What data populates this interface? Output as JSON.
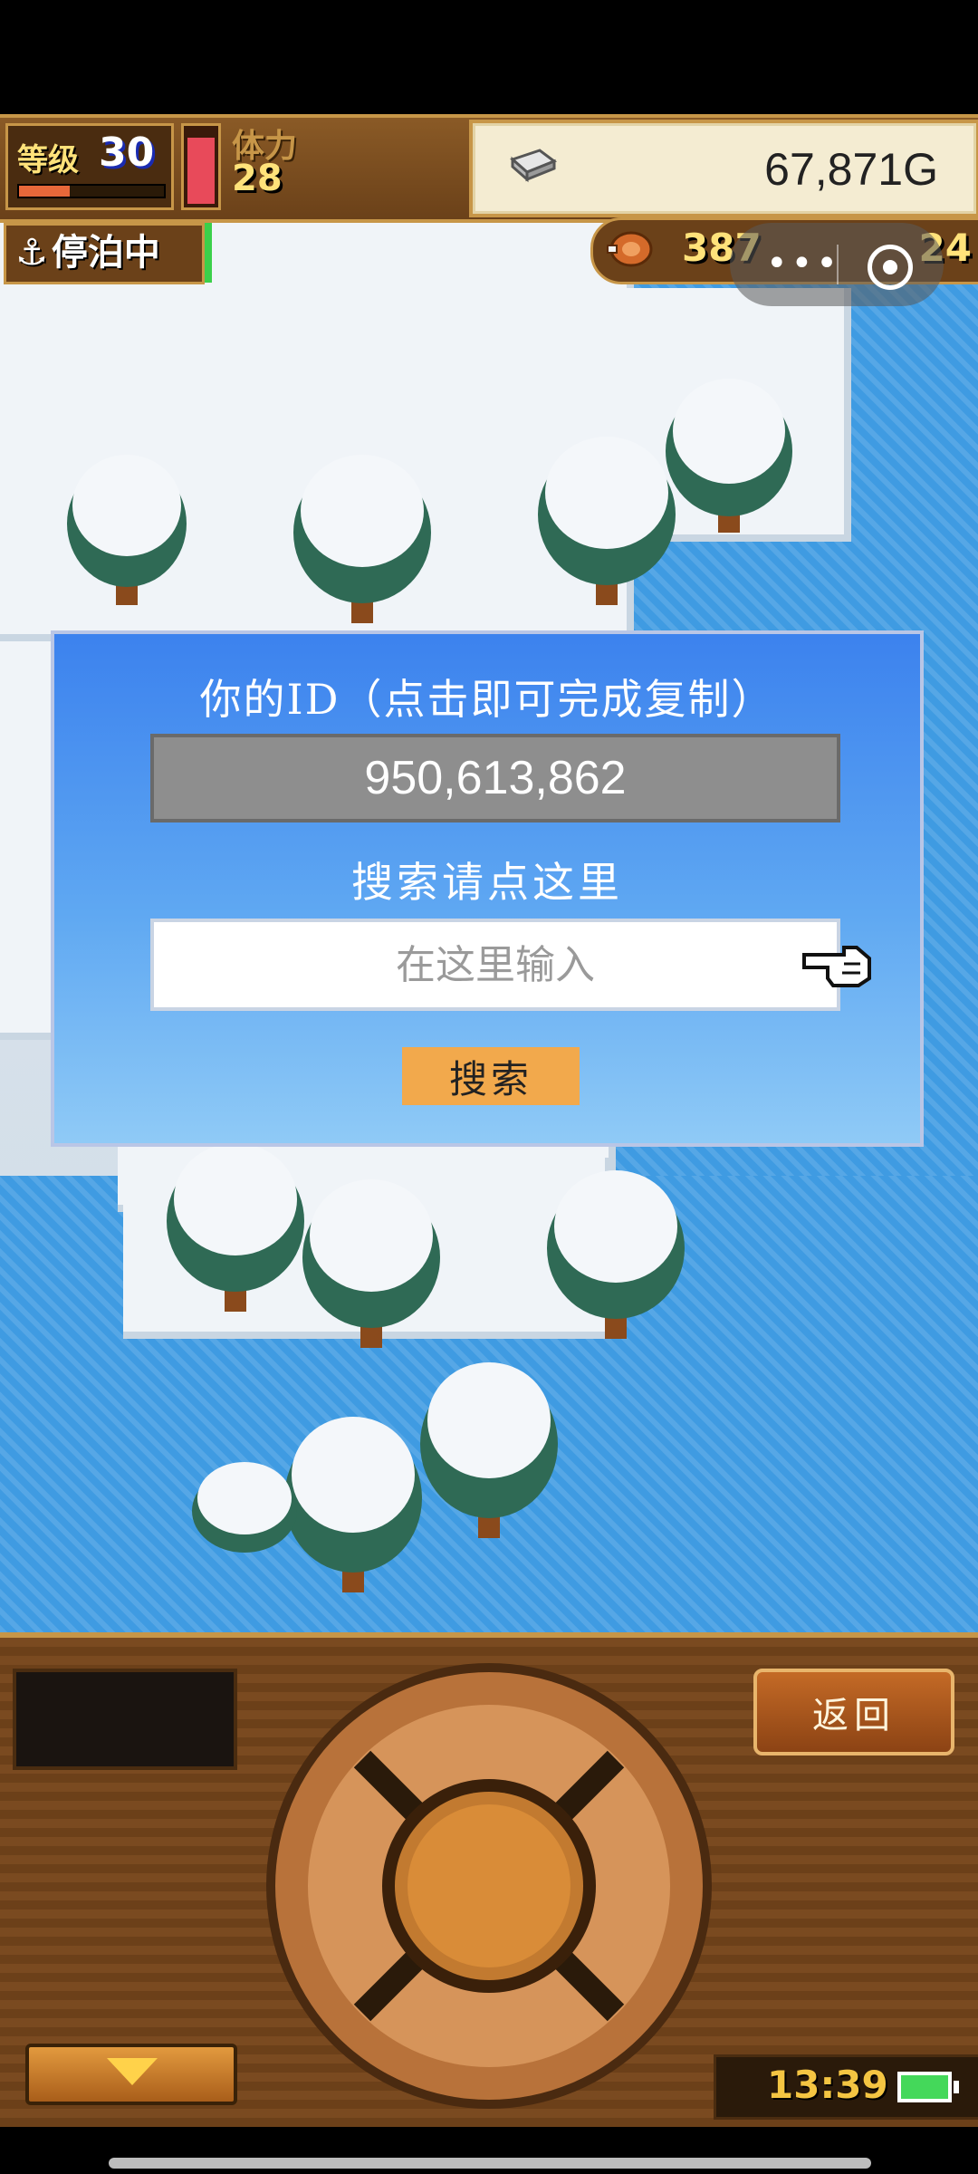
{
  "hud": {
    "level_label": "等级",
    "level_value": "30",
    "level_progress": 0.35,
    "stamina_label": "体力",
    "stamina_value": "28",
    "stamina_fill": 0.9,
    "gold_value": "67,871G",
    "status_label": "停泊中",
    "food_value": "387",
    "crew_value": "24"
  },
  "dialog": {
    "title": "你的ID（点击即可完成复制）",
    "id_value": "950,613,862",
    "search_title": "搜索请点这里",
    "search_placeholder": "在这里输入",
    "search_button": "搜索"
  },
  "console": {
    "back_label": "返回",
    "clock": "13:39"
  },
  "icons": {
    "gold": "gold-bar-icon",
    "anchor": "anchor-icon",
    "food": "meat-icon",
    "pointer": "pointing-hand-icon",
    "battery": "battery-icon"
  },
  "colors": {
    "dialog_top": "#3c82ee",
    "dialog_bottom": "#8fcaf6",
    "search_button": "#f2a94c",
    "id_field": "#8e8e8e"
  }
}
